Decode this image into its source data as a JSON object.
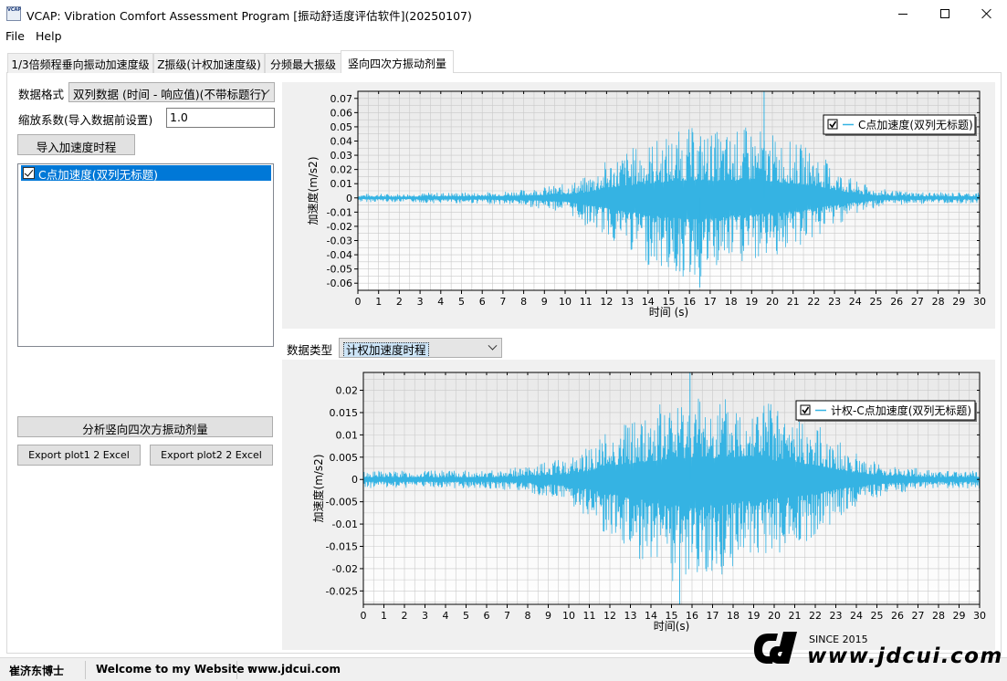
{
  "window": {
    "title": "VCAP: Vibration Comfort Assessment Program [振动舒适度评估软件](20250107)",
    "icon_text": "VCAP"
  },
  "menu": [
    "File",
    "Help"
  ],
  "tabs": [
    {
      "label": "1/3倍频程垂向振动加速度级",
      "active": false
    },
    {
      "label": "Z振级(计权加速度级)",
      "active": false
    },
    {
      "label": "分频最大振级",
      "active": false
    },
    {
      "label": "竖向四次方振动剂量",
      "active": true
    }
  ],
  "left": {
    "format_label": "数据格式",
    "format_value": "双列数据 (时间 - 响应值)(不带标题行)",
    "scale_label": "缩放系数(导入数据前设置)",
    "scale_value": "1.0",
    "import_button": "导入加速度时程",
    "list_items": [
      {
        "label": "C点加速度(双列无标题)",
        "checked": true,
        "selected": true
      }
    ],
    "analyze_button": "分析竖向四次方振动剂量",
    "export1_button": "Export plot1 2 Excel",
    "export2_button": "Export plot2 2 Excel"
  },
  "data_type": {
    "label": "数据类型",
    "value": "计权加速度时程"
  },
  "chart_data": [
    {
      "type": "line",
      "title": "",
      "xlabel": "时间 (s)",
      "ylabel": "加速度(m/s2)",
      "xlim": [
        0,
        30
      ],
      "ylim": [
        -0.065,
        0.075
      ],
      "x_ticks": [
        0,
        1,
        2,
        3,
        4,
        5,
        6,
        7,
        8,
        9,
        10,
        11,
        12,
        13,
        14,
        15,
        16,
        17,
        18,
        19,
        20,
        21,
        22,
        23,
        24,
        25,
        26,
        27,
        28,
        29,
        30
      ],
      "y_ticks": [
        0.07,
        0.06,
        0.05,
        0.04,
        0.03,
        0.02,
        0.01,
        0,
        -0.01,
        -0.02,
        -0.03,
        -0.04,
        -0.05,
        -0.06
      ],
      "y_tick_labels": [
        "0.07",
        "0.06",
        "0.05",
        "0.04",
        "0.03",
        "0.02",
        "0.01",
        "0",
        "-0.01",
        "-0.02",
        "-0.03",
        "-0.04",
        "-0.05",
        "-0.06"
      ],
      "grid": true,
      "legend_position": "top-right",
      "color": "#35b3e3",
      "series": [
        {
          "name": "C点加速度(双列无标题)",
          "envelope": {
            "t": [
              0,
              2,
              4,
              6,
              8,
              9,
              10,
              11,
              12,
              13,
              14,
              15,
              16,
              17,
              18,
              19,
              20,
              21,
              22,
              23,
              24,
              25,
              26,
              28,
              30
            ],
            "upper": [
              0.003,
              0.003,
              0.004,
              0.004,
              0.006,
              0.008,
              0.01,
              0.015,
              0.027,
              0.035,
              0.04,
              0.045,
              0.05,
              0.048,
              0.047,
              0.052,
              0.045,
              0.04,
              0.035,
              0.022,
              0.012,
              0.007,
              0.005,
              0.004,
              0.004
            ],
            "lower": [
              -0.003,
              -0.003,
              -0.004,
              -0.004,
              -0.006,
              -0.008,
              -0.01,
              -0.02,
              -0.028,
              -0.038,
              -0.048,
              -0.055,
              -0.06,
              -0.058,
              -0.05,
              -0.048,
              -0.042,
              -0.038,
              -0.03,
              -0.02,
              -0.012,
              -0.007,
              -0.005,
              -0.004,
              -0.004
            ]
          },
          "peak_max": {
            "x": 19.6,
            "y": 0.077
          },
          "peak_min": {
            "x": 16.5,
            "y": -0.063
          }
        }
      ]
    },
    {
      "type": "line",
      "title": "",
      "xlabel": "时间(s)",
      "ylabel": "加速度(m/s2)",
      "xlim": [
        0,
        30
      ],
      "ylim": [
        -0.028,
        0.024
      ],
      "x_ticks": [
        0,
        1,
        2,
        3,
        4,
        5,
        6,
        7,
        8,
        9,
        10,
        11,
        12,
        13,
        14,
        15,
        16,
        17,
        18,
        19,
        20,
        21,
        22,
        23,
        24,
        25,
        26,
        27,
        28,
        29,
        30
      ],
      "y_ticks": [
        0.02,
        0.015,
        0.01,
        0.005,
        0,
        -0.005,
        -0.01,
        -0.015,
        -0.02,
        -0.025
      ],
      "y_tick_labels": [
        "0.02",
        "0.015",
        "0.01",
        "0.005",
        "0",
        "-0.005",
        "-0.01",
        "-0.015",
        "-0.02",
        "-0.025"
      ],
      "grid": true,
      "legend_position": "top-right",
      "color": "#35b3e3",
      "series": [
        {
          "name": "计权-C点加速度(双列无标题)",
          "envelope": {
            "t": [
              0,
              2,
              4,
              6,
              8,
              9,
              10,
              11,
              12,
              13,
              14,
              15,
              16,
              17,
              18,
              19,
              20,
              21,
              22,
              23,
              24,
              25,
              26,
              28,
              30
            ],
            "upper": [
              0.002,
              0.002,
              0.002,
              0.002,
              0.003,
              0.004,
              0.005,
              0.008,
              0.012,
              0.014,
              0.016,
              0.018,
              0.02,
              0.019,
              0.019,
              0.021,
              0.017,
              0.015,
              0.013,
              0.009,
              0.006,
              0.004,
              0.003,
              0.002,
              0.002
            ],
            "lower": [
              -0.002,
              -0.002,
              -0.002,
              -0.002,
              -0.003,
              -0.004,
              -0.006,
              -0.009,
              -0.013,
              -0.016,
              -0.02,
              -0.023,
              -0.025,
              -0.023,
              -0.02,
              -0.019,
              -0.017,
              -0.015,
              -0.013,
              -0.009,
              -0.006,
              -0.004,
              -0.003,
              -0.002,
              -0.002
            ]
          },
          "peak_max": {
            "x": 15.9,
            "y": 0.025
          },
          "peak_min": {
            "x": 15.4,
            "y": -0.028
          }
        }
      ]
    }
  ],
  "status": {
    "author": "崔济东博士",
    "welcome": "Welcome to my Website :",
    "url": "www.jdcui.com"
  },
  "watermark": {
    "since": "SINCE 2015",
    "url": "www.jdcui.com"
  }
}
